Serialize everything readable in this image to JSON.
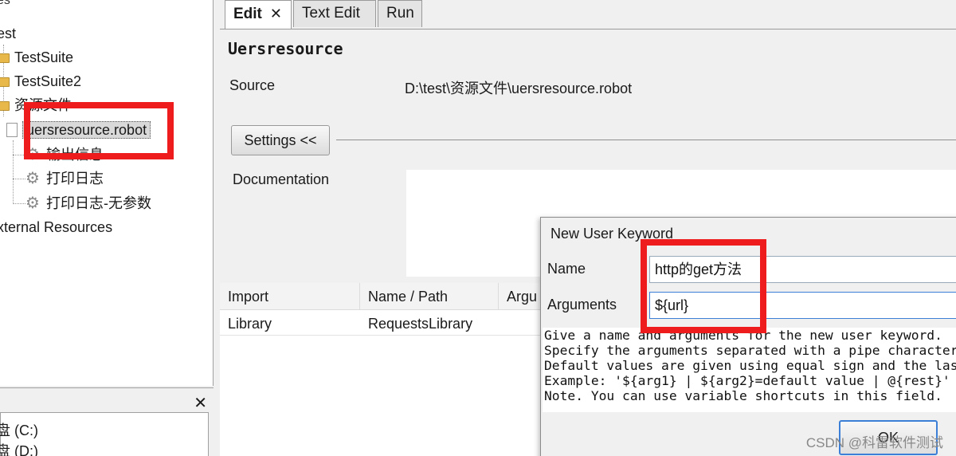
{
  "tree": {
    "header": "es",
    "items": [
      {
        "label": "est"
      },
      {
        "label": "TestSuite"
      },
      {
        "label": "TestSuite2"
      },
      {
        "label": "资源文件"
      },
      {
        "label": "uersresource.robot"
      },
      {
        "label": "输出信息"
      },
      {
        "label": "打印日志"
      },
      {
        "label": "打印日志-无参数"
      },
      {
        "label": "xternal Resources"
      }
    ]
  },
  "drives": {
    "close_label": "✕",
    "items": [
      {
        "label": "盘 (C:)"
      },
      {
        "label": "盘 (D:)"
      }
    ]
  },
  "tabs": [
    {
      "label": "Edit",
      "close": "✕"
    },
    {
      "label": "Text Edit"
    },
    {
      "label": "Run"
    }
  ],
  "editor": {
    "title": "Uersresource",
    "source_label": "Source",
    "source_value": "D:\\test\\资源文件\\uersresource.robot",
    "settings_button": "Settings <<",
    "documentation_label": "Documentation"
  },
  "import_table": {
    "headers": [
      "Import",
      "Name / Path",
      "Argu"
    ],
    "rows": [
      [
        "Library",
        "RequestsLibrary"
      ]
    ]
  },
  "dialog": {
    "title": "New User Keyword",
    "name_label": "Name",
    "name_value": "http的get方法",
    "arguments_label": "Arguments",
    "arguments_value": "${url}",
    "help_lines": [
      "Give a name and arguments for the new user keyword.",
      "Specify the arguments separated with a pipe character",
      "Default values are given using equal sign and the last",
      "Example: '${arg1} | ${arg2}=default value | @{rest}'",
      "Note. You can use variable shortcuts in this field."
    ],
    "ok_label": "OK"
  },
  "watermark": "CSDN @科雷软件测试",
  "colors": {
    "highlight": "#ee1c1c",
    "focus": "#3c7fd6"
  }
}
